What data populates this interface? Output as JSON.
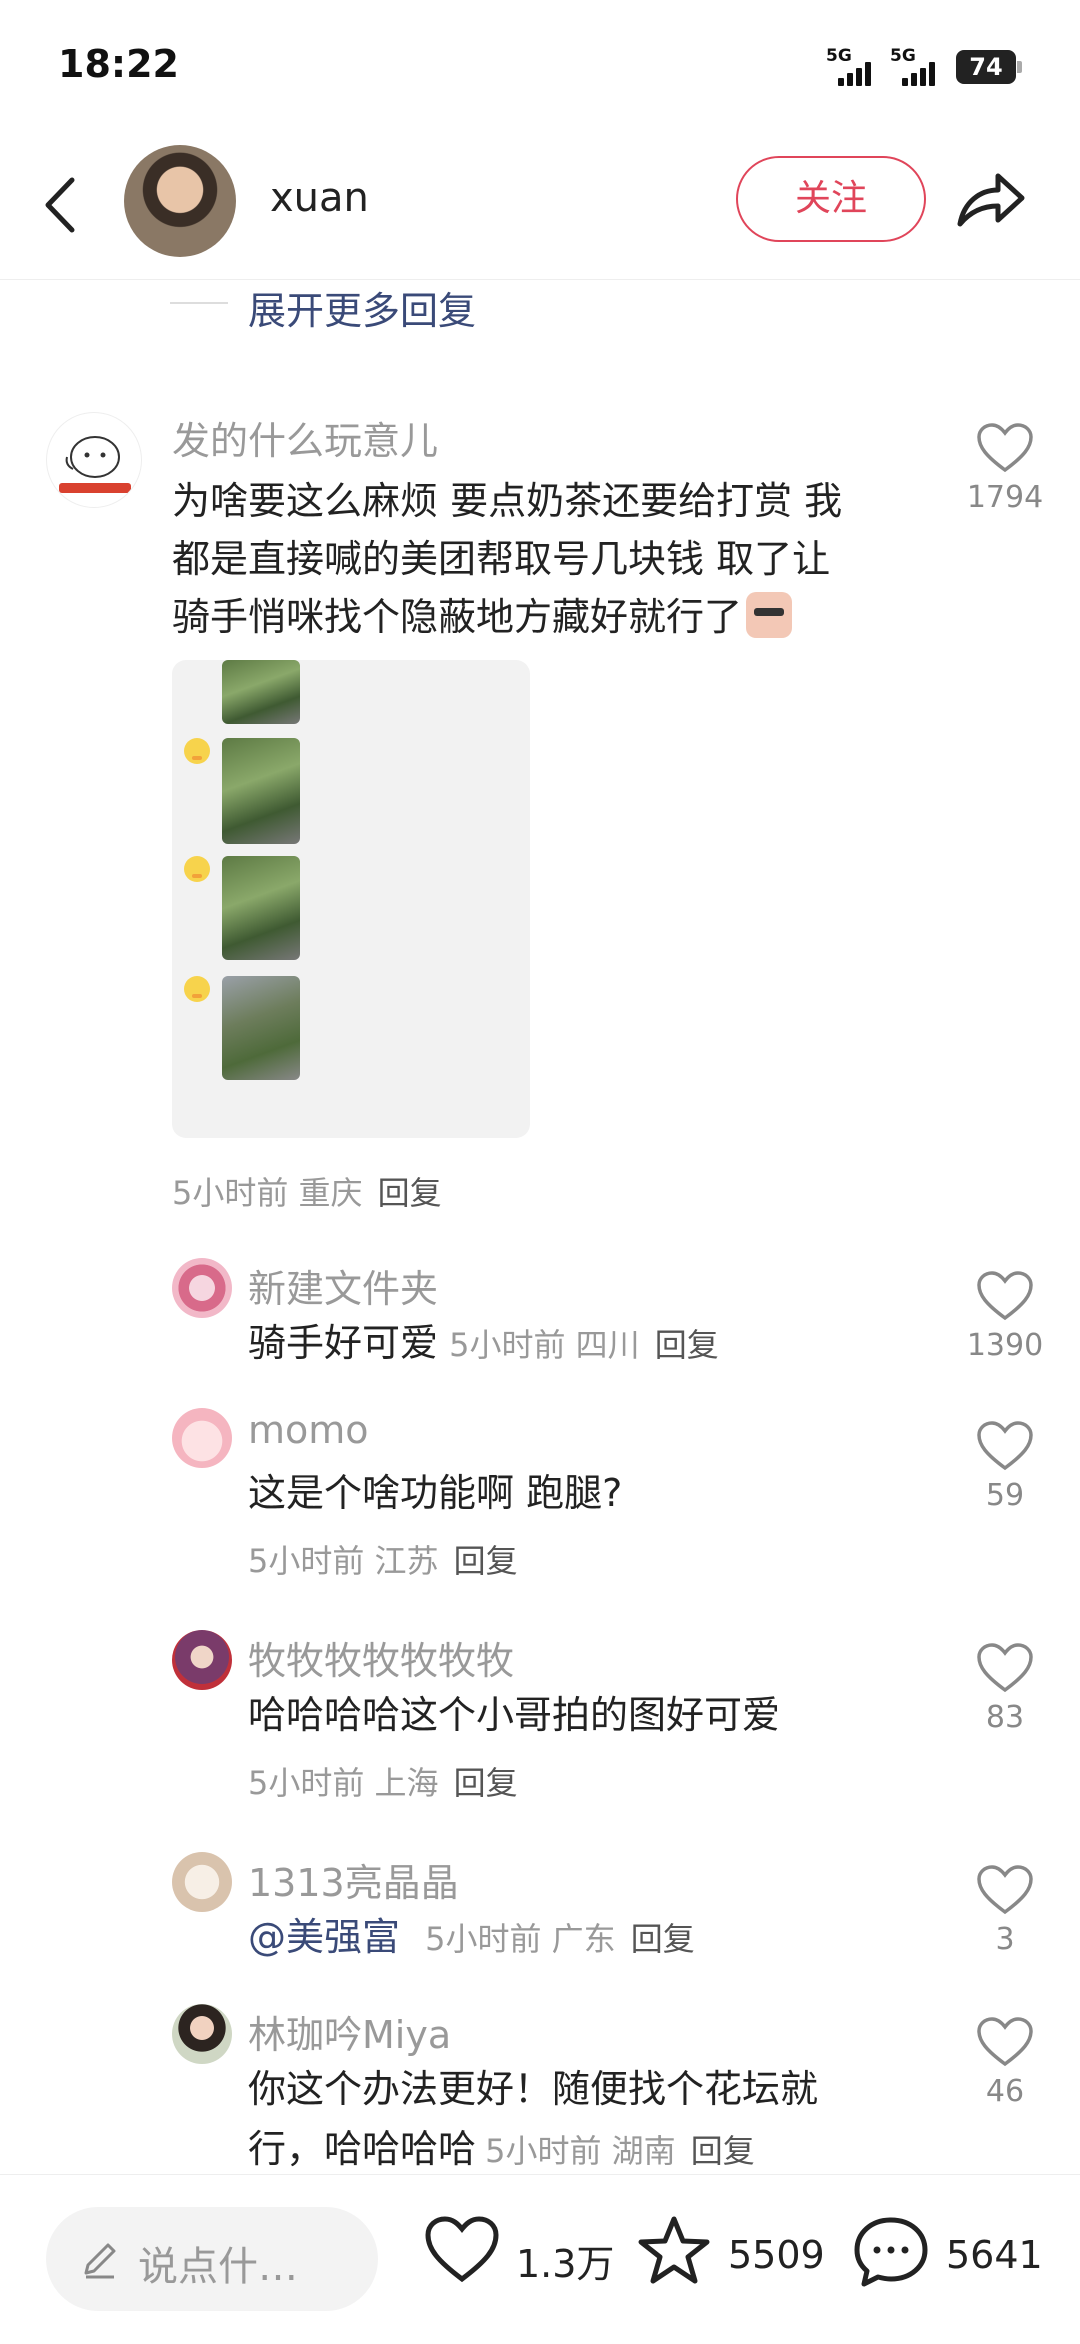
{
  "status_bar": {
    "time": "18:22",
    "signal_1": "5G",
    "signal_2": "5G",
    "battery": "74"
  },
  "header": {
    "back_icon": "chevron-left-icon",
    "user_name": "xuan",
    "follow_label": "关注",
    "share_icon": "share-arrow-icon"
  },
  "expand_more": "展开更多回复",
  "comments": [
    {
      "name": "发的什么玩意儿",
      "text_lines": [
        "为啥要这么麻烦 要点奶茶还要给打赏 我",
        "都是直接喊的美团帮取号几块钱 取了让",
        "骑手悄咪找个隐蔽地方藏好就行了"
      ],
      "emoji": "sunglasses-character-emoji",
      "meta": "5小时前 重庆",
      "reply": "回复",
      "likes": "1794"
    }
  ],
  "replies": [
    {
      "name": "新建文件夹",
      "text": "骑手好可爱",
      "meta": "5小时前 四川",
      "reply": "回复",
      "likes": "1390"
    },
    {
      "name": "momo",
      "text": "这是个啥功能啊 跑腿?",
      "meta": "5小时前 江苏",
      "reply": "回复",
      "likes": "59"
    },
    {
      "name": "牧牧牧牧牧牧牧",
      "text": "哈哈哈哈这个小哥拍的图好可爱",
      "meta": "5小时前 上海",
      "reply": "回复",
      "likes": "83"
    },
    {
      "name": "1313亮晶晶",
      "text": "@美强富",
      "meta": "5小时前 广东",
      "reply": "回复",
      "likes": "3"
    },
    {
      "name": "林珈吟Miya",
      "text_line1": "你这个办法更好！随便找个花坛就",
      "text_line2": "行，哈哈哈哈",
      "meta": "5小时前 湖南",
      "reply": "回复",
      "likes": "46"
    }
  ],
  "bottom_bar": {
    "input_placeholder": "说点什…",
    "likes": "1.3万",
    "favorites": "5509",
    "comments": "5641"
  },
  "colors": {
    "accent": "#e0455a",
    "link": "#3a4a78",
    "muted": "#999999"
  }
}
